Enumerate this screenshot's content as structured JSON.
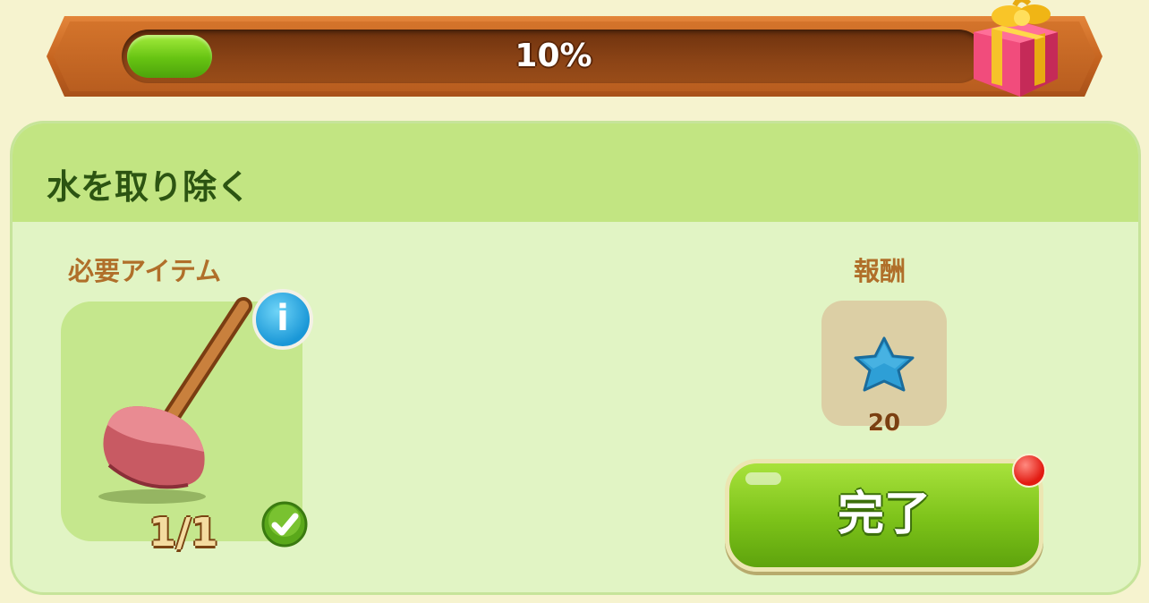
{
  "progress": {
    "percent_text": "10%",
    "fraction": 0.1
  },
  "task": {
    "title": "水を取り除く",
    "required_label": "必要アイテム",
    "reward_label": "報酬",
    "item": {
      "name": "plunger",
      "count": "1/1"
    },
    "reward": {
      "icon": "blue-star",
      "value": "20"
    },
    "complete_label": "完了"
  },
  "colors": {
    "accent_green": "#7cc219",
    "banner_orange": "#c4631f",
    "panel_bg": "#e1f4c4",
    "header_bg": "#c2e582"
  }
}
